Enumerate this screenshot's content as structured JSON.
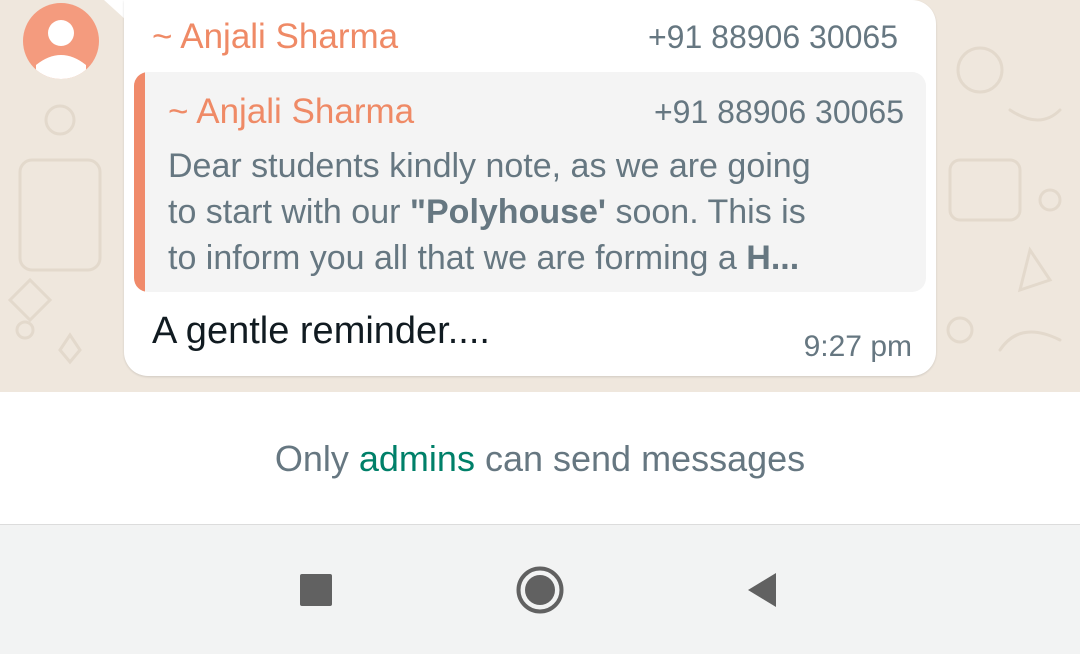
{
  "message": {
    "sender_name": "~ Anjali Sharma",
    "sender_phone": "+91 88906 30065",
    "text": "A gentle reminder....",
    "time": "9:27 pm"
  },
  "quoted": {
    "sender_name": "~ Anjali Sharma",
    "sender_phone": "+91 88906 30065",
    "line1": "Dear students kindly note, as we are going",
    "line2_start": "to start with our ",
    "line2_bold": "\"Polyhouse'",
    "line2_end": " soon. This is",
    "line3_start": "to inform you all that we are forming a ",
    "line3_bold": "H..."
  },
  "footer": {
    "prefix": "Only ",
    "link": "admins",
    "suffix": " can send messages"
  },
  "nav": {
    "icons": [
      "recent-apps-icon",
      "home-icon",
      "back-icon"
    ]
  },
  "colors": {
    "sender": "#ef8a66",
    "accent": "#008069",
    "chat_background": "#efe7dd"
  }
}
